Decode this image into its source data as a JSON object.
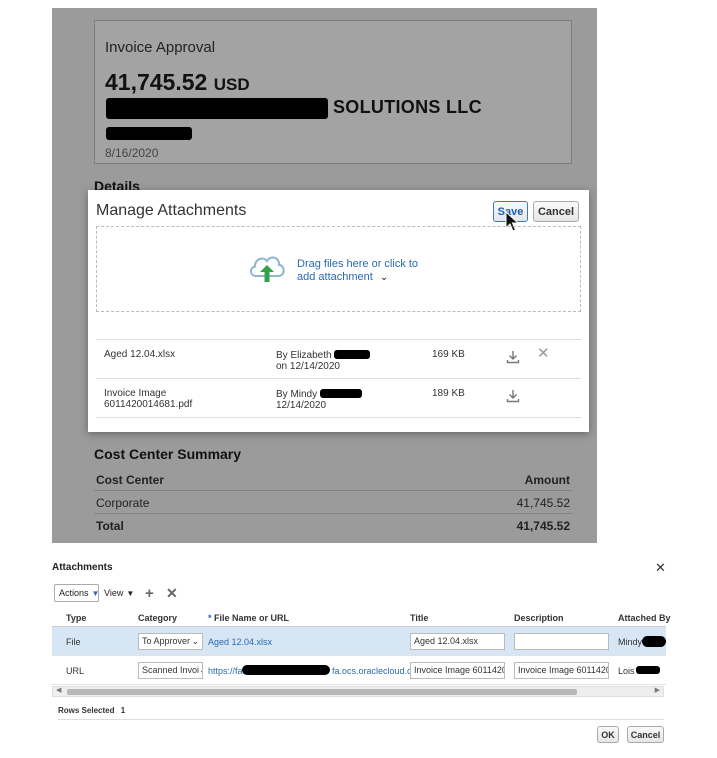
{
  "invoice": {
    "label": "Invoice Approval",
    "amount": "41,745.52",
    "currency": "USD",
    "supplier_suffix": "SOLUTIONS LLC",
    "date": "8/16/2020",
    "details_heading": "Details"
  },
  "modal": {
    "title": "Manage Attachments",
    "save_label": "Save",
    "cancel_label": "Cancel",
    "drop_text": "Drag files here or click to add attachment",
    "icons": {
      "upload": "cloud-upload-icon",
      "download": "download-icon",
      "remove": "close-icon"
    },
    "attachments": [
      {
        "file": "Aged 12.04.xlsx",
        "by": "By Elizabeth",
        "on": "on 12/14/2020",
        "size": "169 KB"
      },
      {
        "file": "Invoice Image 6011420014681.pdf",
        "by": "By Mindy",
        "on": "12/14/2020",
        "size": "189 KB"
      }
    ]
  },
  "cost_center": {
    "heading": "Cost Center Summary",
    "col_center": "Cost Center",
    "col_amount": "Amount",
    "rows": [
      {
        "center": "Corporate",
        "amount": "41,745.52"
      }
    ],
    "total_label": "Total",
    "total_amount": "41,745.52"
  },
  "attachments_dialog": {
    "title": "Attachments",
    "toolbar": {
      "actions": "Actions",
      "view": "View"
    },
    "columns": [
      "Type",
      "Category",
      "File Name or URL",
      "Title",
      "Description",
      "Attached By"
    ],
    "required_marker": "*",
    "rows": [
      {
        "type": "File",
        "category": "To Approver",
        "file": "Aged 12.04.xlsx",
        "title": "Aged 12.04.xlsx",
        "description": "",
        "attached_by": "Mindy"
      },
      {
        "type": "URL",
        "category": "Scanned Invoi",
        "url_start": "https://fa-",
        "url_end": "fa.ocs.oraclecloud.c...",
        "title": "Invoice Image 601142001",
        "description": "Invoice Image 601142001",
        "attached_by": "Lois"
      }
    ],
    "rows_selected_label": "Rows Selected",
    "rows_selected_count": "1",
    "ok_label": "OK",
    "cancel_label": "Cancel"
  }
}
